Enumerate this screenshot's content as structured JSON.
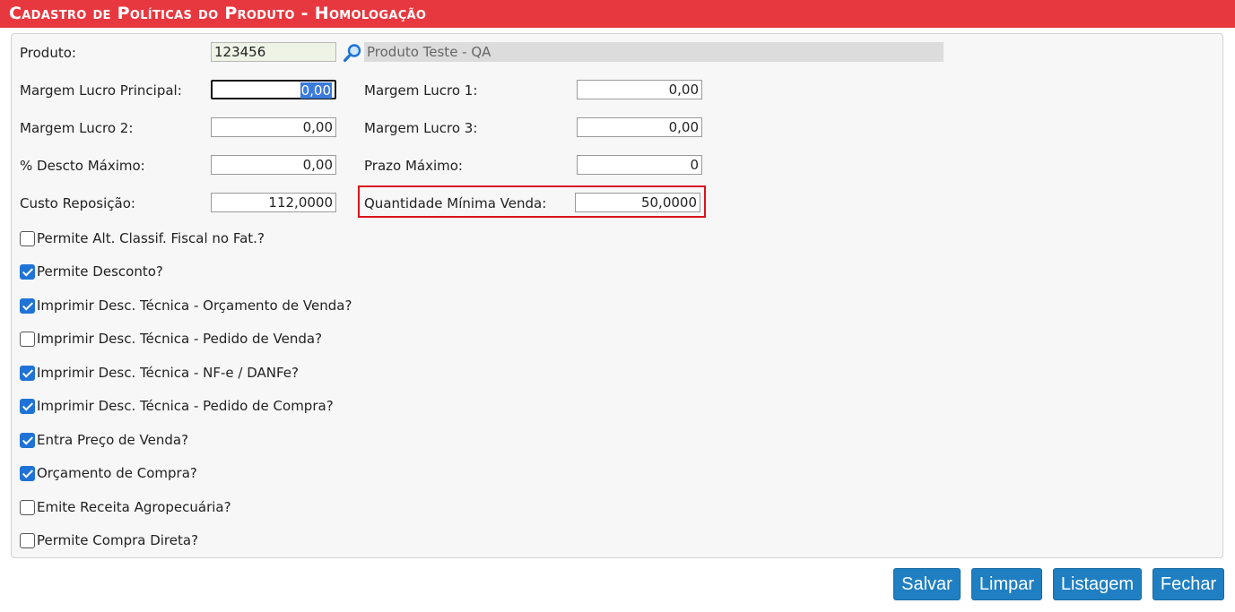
{
  "window": {
    "title": "Cadastro de Políticas do Produto  - Homologação"
  },
  "produto": {
    "label": "Produto:",
    "code": "123456",
    "description": "Produto Teste - QA",
    "search_icon": "search-icon"
  },
  "fields": {
    "margem_principal": {
      "label": "Margem Lucro Principal:",
      "value": "0,00"
    },
    "margem_1": {
      "label": "Margem Lucro 1:",
      "value": "0,00"
    },
    "margem_2": {
      "label": "Margem Lucro 2:",
      "value": "0,00"
    },
    "margem_3": {
      "label": "Margem Lucro 3:",
      "value": "0,00"
    },
    "descto_maximo": {
      "label": "% Descto Máximo:",
      "value": "0,00"
    },
    "prazo_maximo": {
      "label": "Prazo Máximo:",
      "value": "0"
    },
    "custo_reposicao": {
      "label": "Custo Reposição:",
      "value": "112,0000"
    },
    "qtd_minima_venda": {
      "label": "Quantidade Mínima Venda:",
      "value": "50,0000"
    }
  },
  "checkboxes": [
    {
      "label": "Permite Alt. Classif. Fiscal no Fat.?",
      "checked": false
    },
    {
      "label": "Permite Desconto?",
      "checked": true
    },
    {
      "label": "Imprimir Desc. Técnica - Orçamento de Venda?",
      "checked": true
    },
    {
      "label": "Imprimir Desc. Técnica - Pedido de Venda?",
      "checked": false
    },
    {
      "label": "Imprimir Desc. Técnica - NF-e / DANFe?",
      "checked": true
    },
    {
      "label": "Imprimir Desc. Técnica - Pedido de Compra?",
      "checked": true
    },
    {
      "label": "Entra Preço de Venda?",
      "checked": true
    },
    {
      "label": "Orçamento de Compra?",
      "checked": true
    },
    {
      "label": "Emite Receita Agropecuária?",
      "checked": false
    },
    {
      "label": "Permite Compra Direta?",
      "checked": false
    }
  ],
  "buttons": {
    "salvar": "Salvar",
    "limpar": "Limpar",
    "listagem": "Listagem",
    "fechar": "Fechar"
  },
  "colors": {
    "title_bar": "#e8383f",
    "button": "#1f7fc2",
    "highlight": "#d8141b",
    "checkbox": "#1f73d6"
  }
}
